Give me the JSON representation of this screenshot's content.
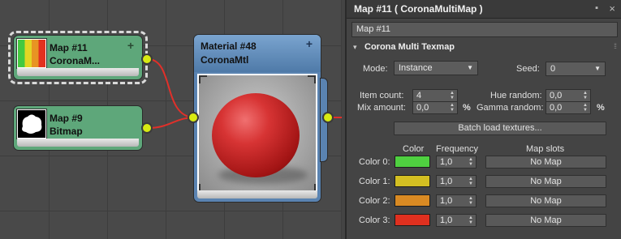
{
  "nodes": {
    "map11": {
      "title": "Map #11",
      "subtitle": "CoronaM...",
      "plus": "+"
    },
    "map9": {
      "title": "Map #9",
      "subtitle": "Bitmap"
    },
    "material": {
      "title": "Material #48",
      "subtitle": "CoronaMtl",
      "plus": "+"
    }
  },
  "panel": {
    "title": "Map #11  ( CoronaMultiMap )",
    "close": "×",
    "name_value": "Map #11",
    "rollout_title": "Corona Multi Texmap",
    "mode_label": "Mode:",
    "mode_value": "Instance",
    "seed_label": "Seed:",
    "seed_value": "0",
    "item_count_label": "Item count:",
    "item_count_value": "4",
    "hue_random_label": "Hue random:",
    "hue_random_value": "0,0",
    "mix_amount_label": "Mix amount:",
    "mix_amount_value": "0,0",
    "gamma_random_label": "Gamma random:",
    "gamma_random_value": "0,0",
    "percent": "%",
    "batch_button": "Batch load textures...",
    "col_color": "Color",
    "col_frequency": "Frequency",
    "col_mapslots": "Map slots",
    "rows": [
      {
        "label": "Color 0:",
        "color": "#4fd040",
        "freq": "1,0",
        "map": "No Map"
      },
      {
        "label": "Color 1:",
        "color": "#d4bf22",
        "freq": "1,0",
        "map": "No Map"
      },
      {
        "label": "Color 2:",
        "color": "#d98a23",
        "freq": "1,0",
        "map": "No Map"
      },
      {
        "label": "Color 3:",
        "color": "#e0301f",
        "freq": "1,0",
        "map": "No Map"
      }
    ]
  },
  "colors": {
    "node_map": "#5ea77a",
    "node_material": "#5a83b1",
    "socket": "#d8ea12",
    "wire": "#e0302a"
  }
}
